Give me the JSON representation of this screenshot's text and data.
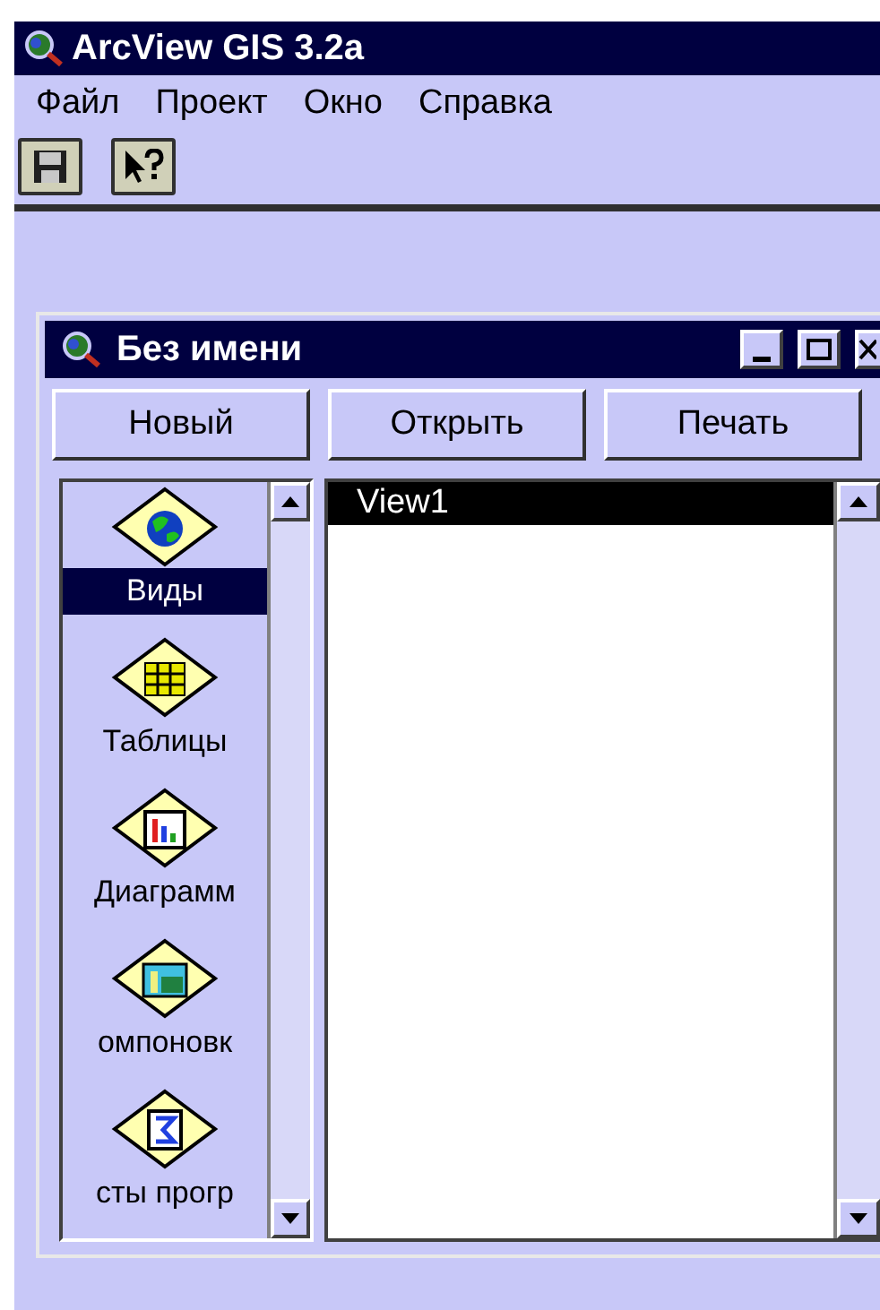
{
  "window": {
    "title": "ArcView GIS 3.2a"
  },
  "menu": [
    "Файл",
    "Проект",
    "Окно",
    "Справка"
  ],
  "toolbar": [
    {
      "kind": "save"
    },
    {
      "kind": "help"
    }
  ],
  "project_window": {
    "title": "Без имени",
    "buttons": [
      "Новый",
      "Открыть",
      "Печать"
    ],
    "doc_types": [
      {
        "kind": "views",
        "label": "Виды",
        "selected": true
      },
      {
        "kind": "tables",
        "label": "Таблицы",
        "selected": false
      },
      {
        "kind": "charts",
        "label": "Диаграмм",
        "selected": false
      },
      {
        "kind": "layouts",
        "label": "омпоновк",
        "selected": false
      },
      {
        "kind": "scripts",
        "label": "сты прогр",
        "selected": false
      }
    ],
    "documents": [
      {
        "label": "View1",
        "selected": true
      }
    ]
  }
}
